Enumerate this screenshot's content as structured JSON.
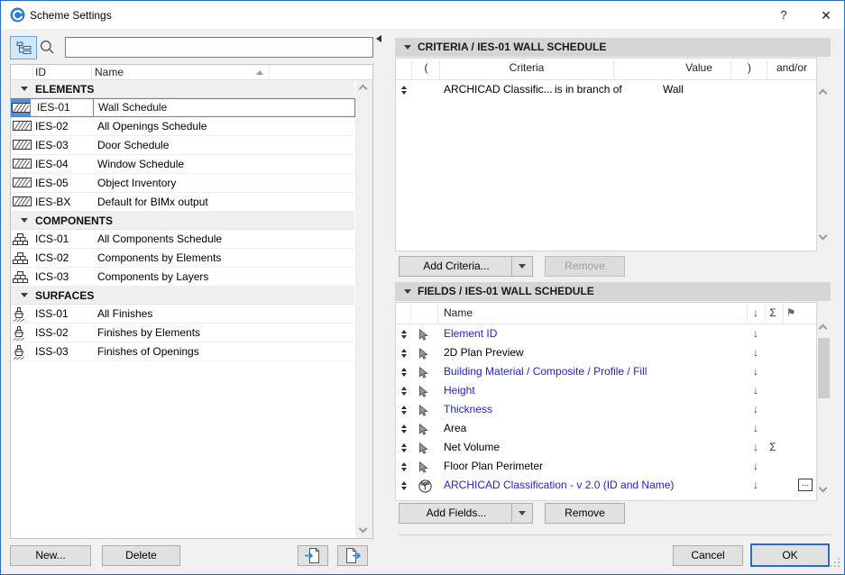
{
  "titlebar": {
    "title": "Scheme Settings",
    "help_label": "?",
    "close_label": "✕"
  },
  "left_panel": {
    "search_value": "",
    "header": {
      "id": "ID",
      "name": "Name"
    },
    "groups": [
      {
        "label": "ELEMENTS",
        "rows": [
          {
            "id": "IES-01",
            "name": "Wall Schedule",
            "icon": "hatch",
            "selected": true
          },
          {
            "id": "IES-02",
            "name": "All Openings Schedule",
            "icon": "hatch"
          },
          {
            "id": "IES-03",
            "name": "Door Schedule",
            "icon": "hatch"
          },
          {
            "id": "IES-04",
            "name": "Window Schedule",
            "icon": "hatch"
          },
          {
            "id": "IES-05",
            "name": "Object Inventory",
            "icon": "hatch"
          },
          {
            "id": "IES-BX",
            "name": "Default for BIMx output",
            "icon": "hatch"
          }
        ]
      },
      {
        "label": "COMPONENTS",
        "rows": [
          {
            "id": "ICS-01",
            "name": "All Components Schedule",
            "icon": "bricks"
          },
          {
            "id": "ICS-02",
            "name": "Components by Elements",
            "icon": "bricks"
          },
          {
            "id": "ICS-03",
            "name": "Components by Layers",
            "icon": "bricks"
          }
        ]
      },
      {
        "label": "SURFACES",
        "rows": [
          {
            "id": "ISS-01",
            "name": "All Finishes",
            "icon": "brush"
          },
          {
            "id": "ISS-02",
            "name": "Finishes by Elements",
            "icon": "brush"
          },
          {
            "id": "ISS-03",
            "name": "Finishes of Openings",
            "icon": "brush"
          }
        ]
      }
    ],
    "buttons": {
      "new": "New...",
      "delete": "Delete"
    }
  },
  "criteria_panel": {
    "title": "CRITERIA / IES-01 WALL SCHEDULE",
    "columns": {
      "paren_open": "(",
      "criteria": "Criteria",
      "value": "Value",
      "paren_close": ")",
      "andor": "and/or"
    },
    "rows": [
      {
        "criteria": "ARCHICAD Classific...",
        "operator": "is in branch of",
        "value": "Wall"
      }
    ],
    "add_button": "Add Criteria...",
    "remove_button": "Remove"
  },
  "fields_panel": {
    "title": "FIELDS / IES-01 WALL SCHEDULE",
    "name_column": "Name",
    "header_icons": {
      "sort": "↓",
      "sum": "Σ",
      "flag": "⚑"
    },
    "more_button": "...",
    "rows": [
      {
        "name": "Element ID",
        "color": "blue",
        "icon": "pointer"
      },
      {
        "name": "2D Plan Preview",
        "color": "black",
        "icon": "pointer"
      },
      {
        "name": "Building Material / Composite / Profile / Fill",
        "color": "blue",
        "icon": "pointer"
      },
      {
        "name": "Height",
        "color": "blue",
        "icon": "pointer"
      },
      {
        "name": "Thickness",
        "color": "blue",
        "icon": "pointer"
      },
      {
        "name": "Area",
        "color": "black",
        "icon": "pointer"
      },
      {
        "name": "Net Volume",
        "color": "black",
        "icon": "pointer",
        "sum": true
      },
      {
        "name": "Floor Plan Perimeter",
        "color": "black",
        "icon": "pointer"
      },
      {
        "name": "ARCHICAD Classification - v 2.0 (ID and Name)",
        "color": "blue",
        "icon": "tree",
        "more": true
      }
    ],
    "add_button": "Add Fields...",
    "remove_button": "Remove"
  },
  "footer": {
    "cancel": "Cancel",
    "ok": "OK"
  },
  "colors": {
    "accent": "#2a6dc0",
    "selection": "#4296e2",
    "field_blue": "#2222cc",
    "header_bar": "#d6d6d6",
    "button_bg": "#e1e1e1",
    "button_border": "#adadad",
    "disabled_text": "#9e9e9e"
  }
}
